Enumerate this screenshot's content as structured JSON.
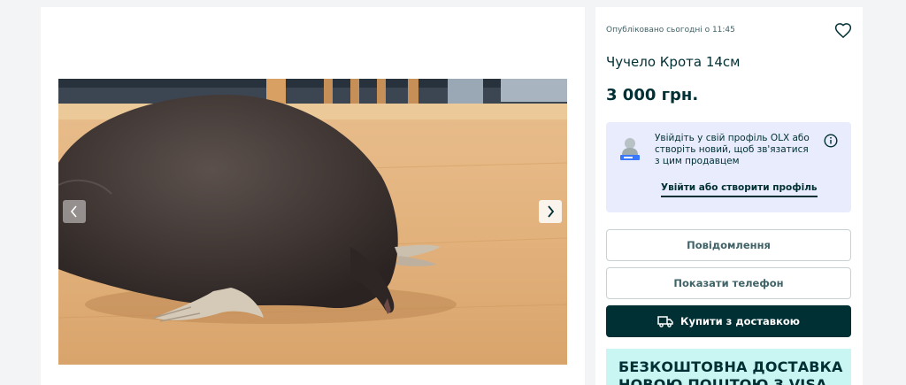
{
  "listing": {
    "published": "Опубліковано сьогодні о 11:45",
    "title": "Чучело Крота 14см",
    "price": "3 000 грн."
  },
  "gallery": {
    "prev_icon": "chevron-left-icon",
    "next_icon": "chevron-right-icon"
  },
  "login_prompt": {
    "text": "Увійдіть у свій профіль OLX або створіть новий, щоб зв'язатися з цим продавцем",
    "link": "Увійти або створити профіль"
  },
  "actions": {
    "message": "Повідомлення",
    "show_phone": "Показати телефон",
    "buy_delivery": "Купити з доставкою"
  },
  "promo": {
    "line1": "БЕЗКОШТОВНА ДОСТАВКА",
    "line2": "НОВОЮ ПОШТОЮ З VISA"
  },
  "colors": {
    "brand_dark": "#002f34",
    "login_bg": "#e8ecfd",
    "promo_bg": "#c9f6f2",
    "page_bg": "#f2f4f5"
  }
}
